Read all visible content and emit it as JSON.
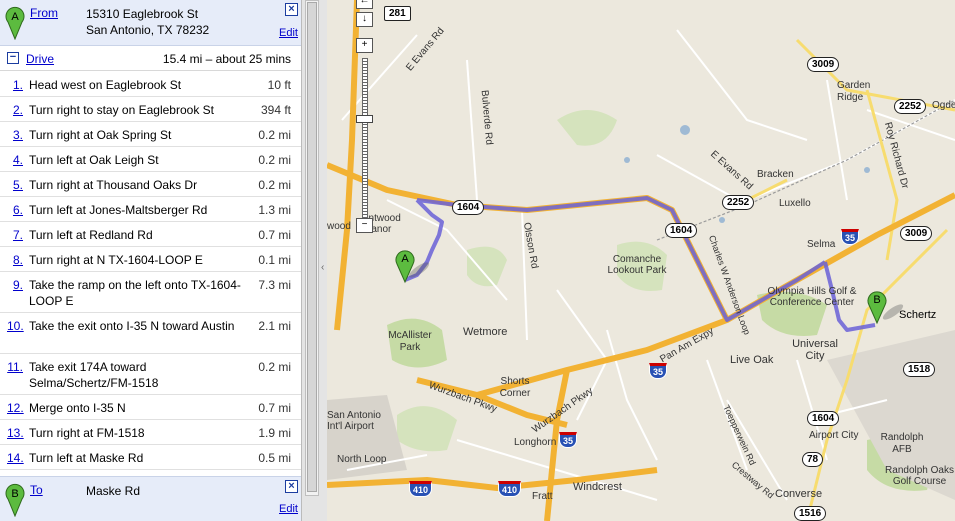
{
  "from": {
    "label": "From",
    "line1": "15310 Eaglebrook St",
    "line2": "San Antonio, TX 78232",
    "edit": "Edit",
    "close": "×",
    "marker": "A"
  },
  "drive": {
    "label": "Drive",
    "summary": "15.4 mi – about 25 mins",
    "toggle": "−"
  },
  "steps": [
    {
      "num": "1.",
      "text": "Head west on Eaglebrook St",
      "dist": "10 ft"
    },
    {
      "num": "2.",
      "text": "Turn right to stay on Eaglebrook St",
      "dist": "394 ft"
    },
    {
      "num": "3.",
      "text": "Turn right at Oak Spring St",
      "dist": "0.2 mi"
    },
    {
      "num": "4.",
      "text": "Turn left at Oak Leigh St",
      "dist": "0.2 mi"
    },
    {
      "num": "5.",
      "text": "Turn right at Thousand Oaks Dr",
      "dist": "0.2 mi"
    },
    {
      "num": "6.",
      "text": "Turn left at Jones-Maltsberger Rd",
      "dist": "1.3 mi"
    },
    {
      "num": "7.",
      "text": "Turn left at Redland Rd",
      "dist": "0.7 mi"
    },
    {
      "num": "8.",
      "text": "Turn right at N TX-1604-LOOP E",
      "dist": "0.1 mi"
    },
    {
      "num": "9.",
      "text": "Take the ramp on the left onto TX-1604-LOOP E",
      "dist": "7.3 mi"
    },
    {
      "num": "10.",
      "text": "Take the exit onto I-35 N toward Austin",
      "dist": "2.1 mi"
    },
    {
      "num": "11.",
      "text": "Take exit 174A toward Selma/Schertz/FM-1518",
      "dist": "0.2 mi"
    },
    {
      "num": "12.",
      "text": "Merge onto I-35 N",
      "dist": "0.7 mi"
    },
    {
      "num": "13.",
      "text": "Turn right at FM-1518",
      "dist": "1.9 mi"
    },
    {
      "num": "14.",
      "text": "Turn left at Maske Rd",
      "dist": "0.5 mi"
    }
  ],
  "to": {
    "label": "To",
    "line1": "Maske Rd",
    "edit": "Edit",
    "close": "×",
    "marker": "B"
  },
  "map": {
    "zoom_in": "+",
    "zoom_out": "−",
    "pan_down": "↓",
    "labels": {
      "e_evans_rd_nw": "E Evans Rd",
      "bulverde_rd": "Bulverde Rd",
      "garden_ridge": "Garden Ridge",
      "ogden": "Ogde",
      "roy_richard": "Roy Richard Dr",
      "e_evans_rd_e": "E Evans Rd",
      "bracken": "Bracken",
      "luxello": "Luxello",
      "entwood_manor": "entwood Manor",
      "wood": "wood",
      "olsson_rd": "Olsson Rd",
      "comanche": "Comanche Lookout Park",
      "selma": "Selma",
      "olympia": "Olympia Hills Golf & Conference Center",
      "schertz": "Schertz",
      "charles_anderson": "Charles W Anderson Loop",
      "mcallister": "McAllister Park",
      "wetmore": "Wetmore",
      "universal_city": "Universal City",
      "live_oak": "Live Oak",
      "pan_am": "Pan Am Expy",
      "shorts_corner": "Shorts Corner",
      "wurzbach_pkwy": "Wurzbach Pkwy",
      "wurzbach_pkwy2": "Wurzbach Pkwy",
      "sa_airport": "San Antonio Int'l Airport",
      "longhorn": "Longhorn",
      "north_loop": "North Loop",
      "toepperwein": "Toepperwein Rd",
      "airport_city": "Airport City",
      "randolph_afb": "Randolph AFB",
      "randolph_oaks": "Randolph Oaks Golf Course",
      "crestway": "Crestway Rd",
      "converse": "Converse",
      "windcrest": "Windcrest",
      "fratt": "Fratt"
    },
    "shields": {
      "s281": "281",
      "s3009a": "3009",
      "s2252a": "2252",
      "s1604a": "1604",
      "s2252b": "2252",
      "s1604b": "1604",
      "s3009b": "3009",
      "s1518": "1518",
      "s1604c": "1604",
      "s78": "78",
      "s1516": "1516"
    },
    "interstates": {
      "i35a": "35",
      "i35b": "35",
      "i35c": "35",
      "i35d": "35",
      "i410a": "410",
      "i410b": "410"
    },
    "colors": {
      "highway": "#f2b233",
      "route": "#6a61d8",
      "park": "#c6dba5",
      "water": "#9fbad4"
    }
  }
}
